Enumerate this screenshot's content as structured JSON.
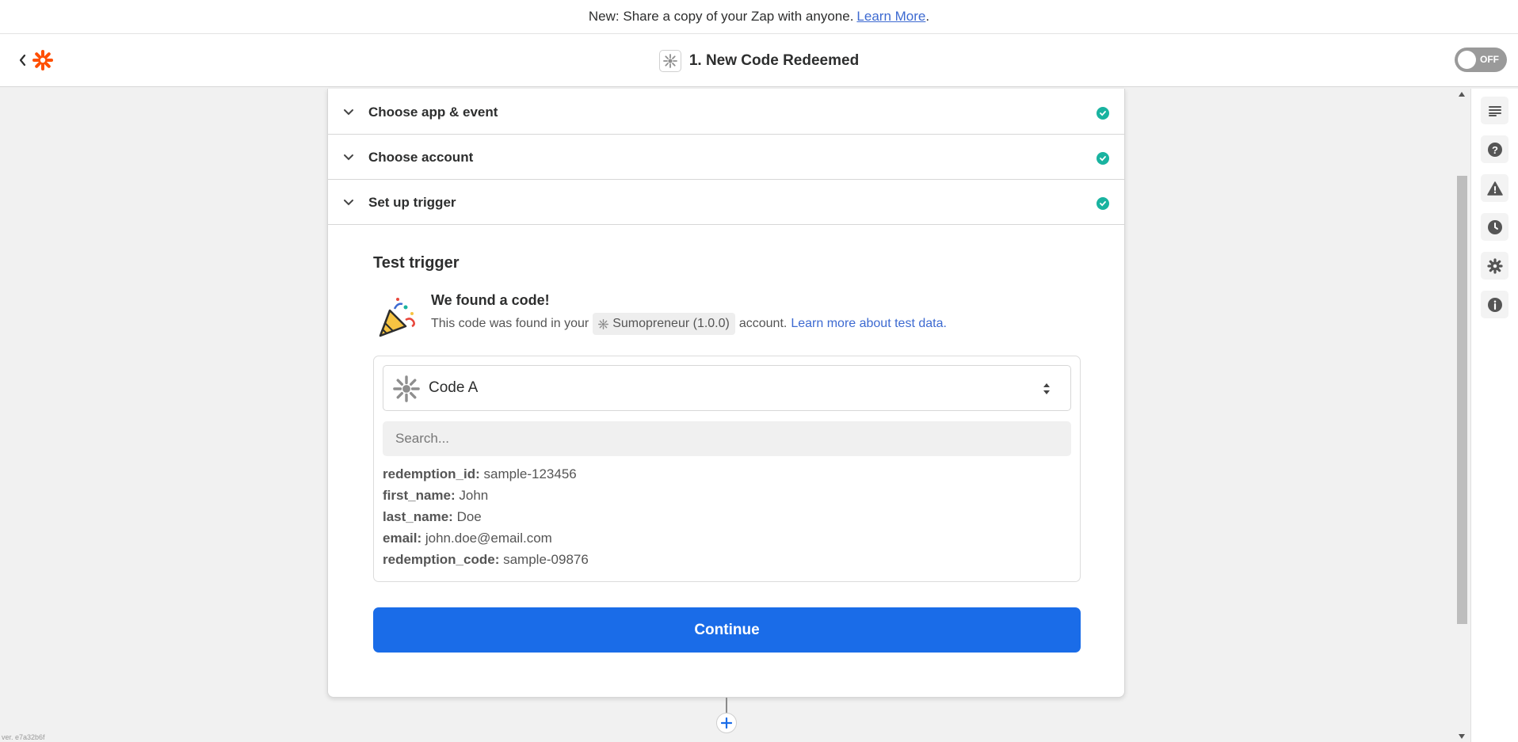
{
  "banner": {
    "text": "New: Share a copy of your Zap with anyone.",
    "link": "Learn More",
    "period": "."
  },
  "header": {
    "title": "1. New Code Redeemed",
    "toggle_label": "OFF",
    "brand_color": "#ff4f00"
  },
  "sections": [
    {
      "label": "Choose app & event",
      "status": "complete"
    },
    {
      "label": "Choose account",
      "status": "complete"
    },
    {
      "label": "Set up trigger",
      "status": "complete"
    }
  ],
  "test": {
    "title": "Test trigger",
    "found_title": "We found a code!",
    "desc_prefix": "This code was found in your",
    "account": "Sumopreneur (1.0.0)",
    "desc_suffix": "account.",
    "learn_link": "Learn more about test data."
  },
  "results": {
    "selected": "Code A",
    "search_placeholder": "Search...",
    "fields": [
      {
        "key": "redemption_id:",
        "value": "sample-123456"
      },
      {
        "key": "first_name:",
        "value": "John"
      },
      {
        "key": "last_name:",
        "value": "Doe"
      },
      {
        "key": "email:",
        "value": "john.doe@email.com"
      },
      {
        "key": "redemption_code:",
        "value": "sample-09876"
      }
    ]
  },
  "continue_label": "Continue",
  "version": "ver. e7a32b6f",
  "sidebar_icons": [
    "outline-icon",
    "help-icon",
    "warning-icon",
    "history-icon",
    "settings-icon",
    "info-icon"
  ],
  "colors": {
    "accent": "#1a6ce8",
    "success": "#19b3a0",
    "link": "#3d6ad1"
  }
}
